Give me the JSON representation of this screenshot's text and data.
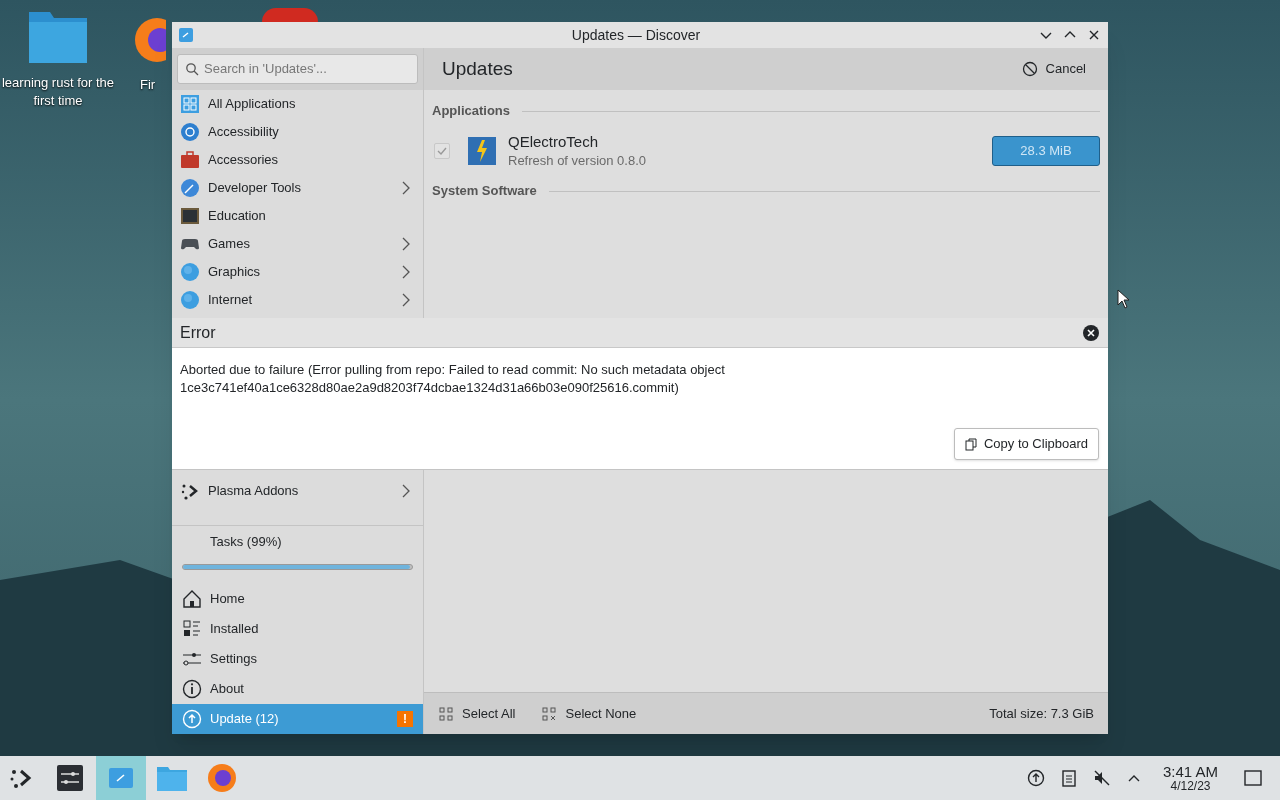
{
  "desktop": {
    "icons": [
      {
        "label": "learning rust for the first time",
        "kind": "folder"
      },
      {
        "label": "Fir",
        "kind": "browser"
      }
    ]
  },
  "window": {
    "title": "Updates — Discover"
  },
  "search": {
    "placeholder": "Search in 'Updates'..."
  },
  "header": {
    "title": "Updates",
    "cancel": "Cancel"
  },
  "sidebar": {
    "categories": [
      {
        "label": "All Applications",
        "has_children": false
      },
      {
        "label": "Accessibility",
        "has_children": false
      },
      {
        "label": "Accessories",
        "has_children": false
      },
      {
        "label": "Developer Tools",
        "has_children": true
      },
      {
        "label": "Education",
        "has_children": false
      },
      {
        "label": "Games",
        "has_children": true
      },
      {
        "label": "Graphics",
        "has_children": true
      },
      {
        "label": "Internet",
        "has_children": true
      },
      {
        "label": "Plasma Addons",
        "has_children": true
      }
    ],
    "tasks": {
      "label": "Tasks (99%)",
      "level": 0.99
    },
    "nav": [
      {
        "label": "Home",
        "selected": false
      },
      {
        "label": "Installed",
        "selected": false
      },
      {
        "label": "Settings",
        "selected": false
      },
      {
        "label": "About",
        "selected": false
      },
      {
        "label": "Update (12)",
        "selected": true,
        "badge": "!"
      }
    ]
  },
  "sections": [
    {
      "heading": "Applications",
      "items": [
        {
          "name": "QElectroTech",
          "description": "Refresh of version 0.8.0",
          "checked": true,
          "size": "28.3 MiB"
        }
      ]
    },
    {
      "heading": "System Software"
    }
  ],
  "error_dialog": {
    "title": "Error",
    "message": "Aborted due to failure (Error pulling from repo: Failed to read commit: No such metadata object 1ce3c741ef40a1ce6328d80ae2a9d8203f74dcbae1324d31a66b03e090f25616.commit)",
    "copy_button": "Copy to Clipboard"
  },
  "footer": {
    "select_all": "Select All",
    "select_none": "Select None",
    "total_size": "Total size: 7.3 GiB"
  },
  "taskbar": {
    "time": "3:41 AM",
    "date": "4/12/23"
  }
}
